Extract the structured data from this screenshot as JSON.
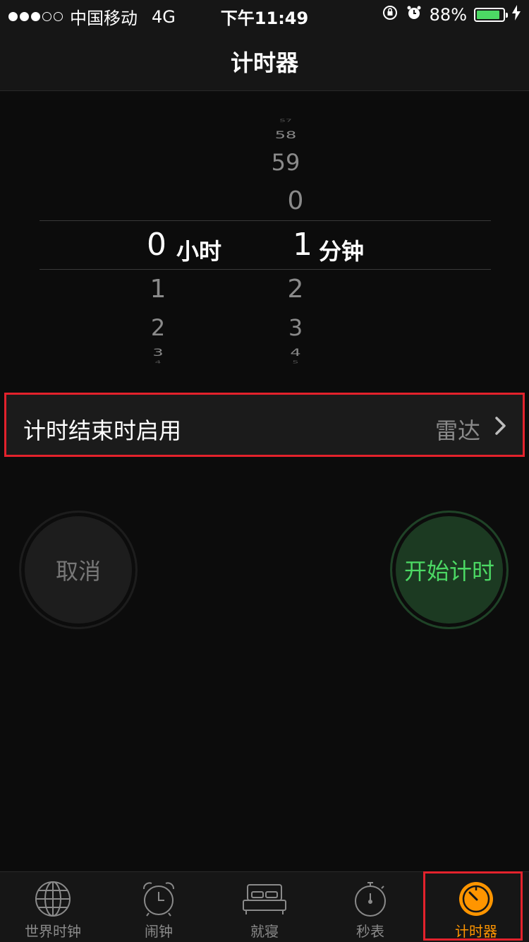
{
  "status_bar": {
    "carrier": "中国移动",
    "network": "4G",
    "time": "下午11:49",
    "battery_percent": "88%",
    "battery_level": 0.88
  },
  "nav": {
    "title": "计时器"
  },
  "picker": {
    "hours_above": [
      "1",
      "2",
      "3"
    ],
    "hours_selected": "0",
    "hours_unit": "小时",
    "minutes_above": [
      "57",
      "58",
      "59",
      "0"
    ],
    "minutes_selected": "1",
    "minutes_unit": "分钟",
    "minutes_below": [
      "2",
      "3",
      "4",
      "5"
    ],
    "hours_below": [
      "1",
      "2",
      "3",
      "4"
    ]
  },
  "end_row": {
    "label": "计时结束时启用",
    "value": "雷达"
  },
  "buttons": {
    "cancel": "取消",
    "start": "开始计时"
  },
  "tabs": [
    {
      "label": "世界时钟",
      "icon": "globe-icon"
    },
    {
      "label": "闹钟",
      "icon": "alarm-clock-icon"
    },
    {
      "label": "就寝",
      "icon": "bed-icon"
    },
    {
      "label": "秒表",
      "icon": "stopwatch-icon"
    },
    {
      "label": "计时器",
      "icon": "timer-icon",
      "active": true
    }
  ],
  "colors": {
    "accent": "#ff9500",
    "start_green": "#4cd964",
    "highlight_red": "#e3222c"
  }
}
